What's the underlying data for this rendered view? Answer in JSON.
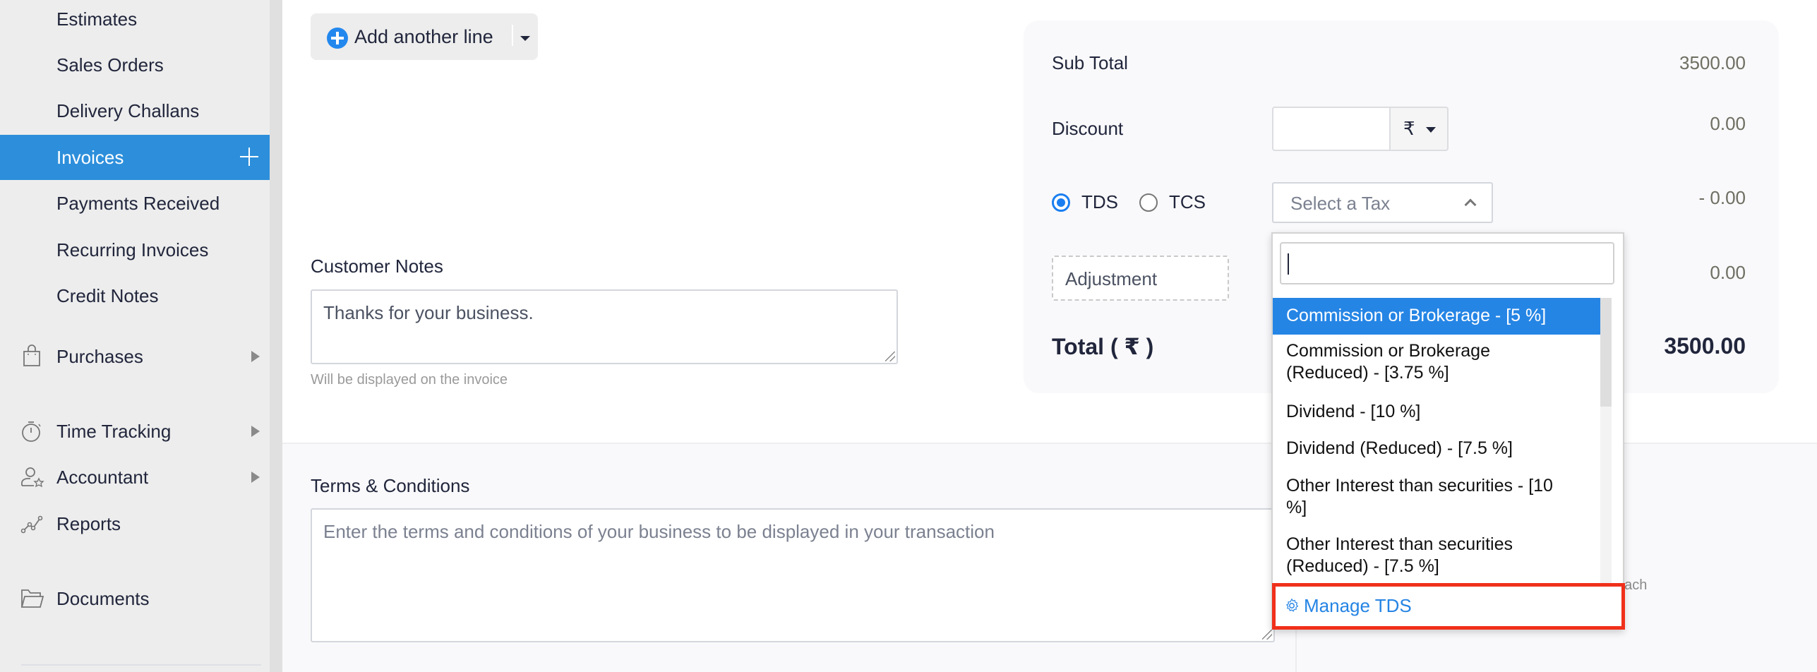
{
  "sidebar": {
    "items": [
      {
        "label": "Estimates"
      },
      {
        "label": "Sales Orders"
      },
      {
        "label": "Delivery Challans"
      },
      {
        "label": "Invoices",
        "active": true
      },
      {
        "label": "Payments Received"
      },
      {
        "label": "Recurring Invoices"
      },
      {
        "label": "Credit Notes"
      }
    ],
    "sections": [
      {
        "label": "Purchases",
        "icon": "shopping-bag-icon",
        "has_submenu": true
      },
      {
        "label": "Time Tracking",
        "icon": "stopwatch-icon",
        "has_submenu": true
      },
      {
        "label": "Accountant",
        "icon": "accountant-icon",
        "has_submenu": true
      },
      {
        "label": "Reports",
        "icon": "chart-line-icon",
        "has_submenu": false
      },
      {
        "label": "Documents",
        "icon": "folder-icon",
        "has_submenu": false
      }
    ],
    "accent": "#2d8fdb"
  },
  "add_line": {
    "label": "Add another line"
  },
  "customer_notes": {
    "label": "Customer Notes",
    "value": "Thanks for your business.",
    "hint": "Will be displayed on the invoice"
  },
  "terms": {
    "label": "Terms & Conditions",
    "placeholder": "Enter the terms and conditions of your business to be displayed in your transaction"
  },
  "summary": {
    "subtotal_label": "Sub Total",
    "subtotal_value": "3500.00",
    "discount_label": "Discount",
    "discount_input": "",
    "discount_type": "₹",
    "discount_value": "0.00",
    "tds_label": "TDS",
    "tcs_label": "TCS",
    "selected_tax_type": "TDS",
    "select_tax_placeholder": "Select a Tax",
    "tax_value": "- 0.00",
    "adjustment_label": "Adjustment",
    "adjustment_value": "0.00",
    "total_label": "Total ( ₹ )",
    "total_value": "3500.00"
  },
  "tax_dropdown": {
    "search_value": "",
    "options": [
      "Commission or Brokerage - [5 %]",
      "Commission or Brokerage (Reduced) - [3.75 %]",
      "Dividend - [10 %]",
      "Dividend (Reduced) - [7.5 %]",
      "Other Interest than securities - [10 %]",
      "Other Interest than securities (Reduced) - [7.5 %]"
    ],
    "highlighted_index": 0,
    "manage_label": "Manage TDS",
    "highlight_color": "#2585e5",
    "callout_color": "#f0301b"
  },
  "partial_text": "each"
}
